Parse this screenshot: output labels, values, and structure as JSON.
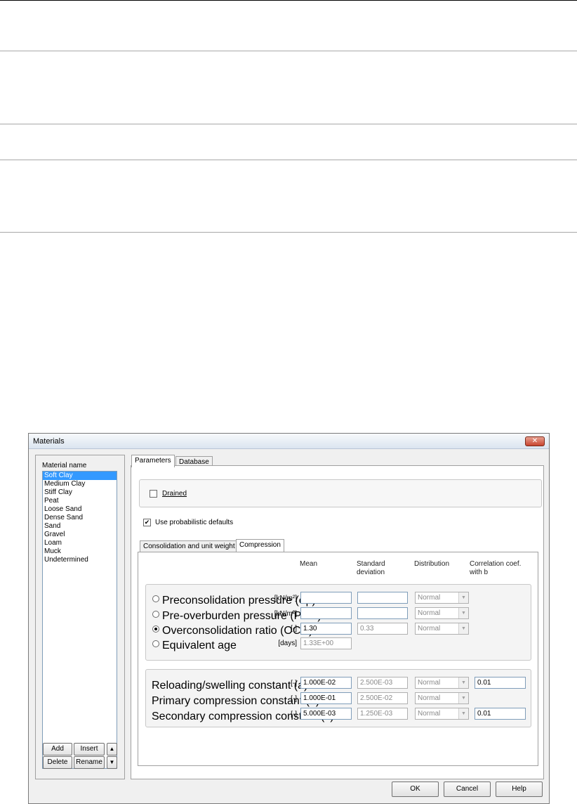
{
  "dialog": {
    "title": "Materials",
    "close_glyph": "✕"
  },
  "left_panel": {
    "label": "Material name",
    "materials": [
      "Soft Clay",
      "Medium Clay",
      "Stiff Clay",
      "Peat",
      "Loose Sand",
      "Dense Sand",
      "Sand",
      "Gravel",
      "Loam",
      "Muck",
      "Undetermined"
    ],
    "selected": "Soft Clay",
    "buttons": {
      "add": "Add",
      "insert": "Insert",
      "delete": "Delete",
      "rename": "Rename",
      "up": "▲",
      "down": "▼"
    }
  },
  "tabs": {
    "parameters": "Parameters",
    "database": "Database"
  },
  "drained": {
    "label": "Drained",
    "checked": false
  },
  "probabilistic": {
    "label": "Use probabilistic defaults",
    "checked": true,
    "check_glyph": "✔"
  },
  "subtabs": {
    "consolidation": "Consolidation and unit weight",
    "compression": "Compression"
  },
  "columns": {
    "mean": "Mean",
    "std_line1": "Standard",
    "std_line2": "deviation",
    "distribution": "Distribution",
    "corr_line1": "Correlation coef.",
    "corr_line2": "with b"
  },
  "consolidation_rows": [
    {
      "label": "Preconsolidation pressure  (σp)",
      "unit": "[kN/m²]",
      "mean": "",
      "std": "",
      "distribution": "Normal",
      "selected": false
    },
    {
      "label": "Pre-overburden pressure (POP)",
      "unit": "[kN/m²]",
      "mean": "",
      "std": "",
      "distribution": "Normal",
      "selected": false
    },
    {
      "label": "Overconsolidation ratio (OCR)",
      "unit": "[-]",
      "mean": "1.30",
      "std": "0.33",
      "distribution": "Normal",
      "selected": true
    },
    {
      "label": "Equivalent age",
      "unit": "[days]",
      "mean": "1.33E+00",
      "selected": false
    }
  ],
  "compression_rows": [
    {
      "label": "Reloading/swelling constant (a)",
      "unit": "[-]",
      "mean": "1.000E-02",
      "std": "2.500E-03",
      "distribution": "Normal",
      "corr": "0.01"
    },
    {
      "label": "Primary compression constant (b)",
      "unit": "[-]",
      "mean": "1.000E-01",
      "std": "2.500E-02",
      "distribution": "Normal"
    },
    {
      "label": "Secondary compression constant (c)",
      "unit": "[-]",
      "mean": "5.000E-03",
      "std": "1.250E-03",
      "distribution": "Normal",
      "corr": "0.01"
    }
  ],
  "footer": {
    "ok": "OK",
    "cancel": "Cancel",
    "help": "Help"
  },
  "icons": {
    "dropdown": "▼"
  }
}
